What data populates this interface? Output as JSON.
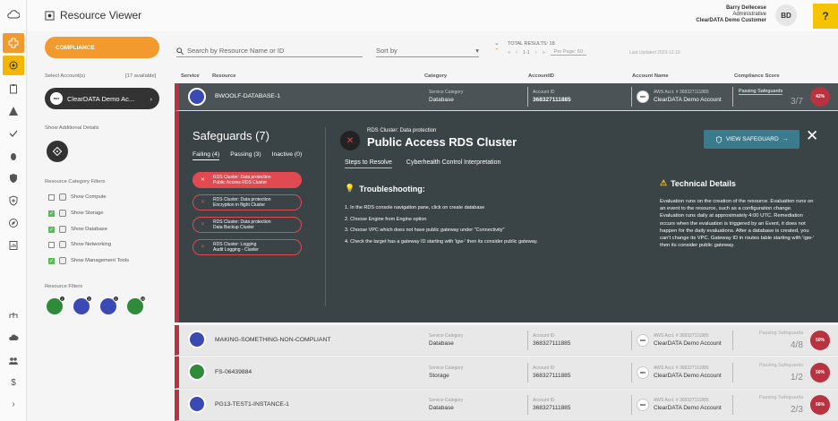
{
  "app": {
    "title": "Resource Viewer"
  },
  "user": {
    "name": "Barry Dellecese",
    "role": "Administrative",
    "org": "ClearDATA Demo Customer",
    "initials": "BD"
  },
  "help_label": "?",
  "rail_icons": [
    "cloud-gear-icon",
    "plus-network-icon",
    "target-icon",
    "clipboard-icon",
    "warning-icon",
    "check-icon",
    "bug-icon",
    "shield-icon",
    "shield-plus-icon",
    "compass-icon",
    "report-icon",
    "users-tree-icon",
    "cloud-upload-icon",
    "team-icon",
    "dollar-icon",
    "chevron-right-icon"
  ],
  "left": {
    "compliance_label": "COMPLIANCE",
    "select_accounts_label": "Select Account(s)",
    "available_label": "[17 available]",
    "account_badge": "aws",
    "account_name": "ClearDATA Demo Ac...",
    "show_details_label": "Show Additional Details",
    "category_filters_label": "Resource Category Filters",
    "categories": [
      {
        "label": "Show Compute",
        "checked": false
      },
      {
        "label": "Show Storage",
        "checked": true
      },
      {
        "label": "Show Database",
        "checked": true
      },
      {
        "label": "Show Networking",
        "checked": false
      },
      {
        "label": "Show Management Tools",
        "checked": true
      }
    ],
    "resource_filters_label": "Resource Filters",
    "resource_filters": [
      {
        "color": "green",
        "count": "1"
      },
      {
        "color": "blue",
        "count": "2"
      },
      {
        "color": "blue",
        "count": "2"
      },
      {
        "color": "green",
        "count": "13"
      }
    ]
  },
  "toolbar": {
    "search_placeholder": "Search by Resource Name or ID",
    "sort_label": "Sort by",
    "total_results": "TOTAL RESULTS: 18",
    "page_range": "1-1",
    "per_page": "Per Page: 50",
    "last_updated": "Last Updated 2023-12-19"
  },
  "columns": [
    "Service",
    "Resource",
    "Category",
    "AccountID",
    "Account Name",
    "Compliance Score"
  ],
  "rows": [
    {
      "name": "BWOOLF-DATABASE-1",
      "cat_label": "Service Category",
      "category": "Database",
      "acct_label": "Account ID",
      "account_id": "368327111885",
      "aws_acct": "AWS Acct. # 368327111885",
      "account_name": "ClearDATA Demo Account",
      "score_label": "Passing Safeguards",
      "score": "3/7",
      "pct": "42%"
    },
    {
      "name": "MAKING-SOMETHING-NON-COMPLIANT",
      "cat_label": "Service Category",
      "category": "Database",
      "acct_label": "Account ID",
      "account_id": "368327111885",
      "aws_acct": "AWS Acct. # 368327111885",
      "account_name": "ClearDATA Demo Account",
      "score_label": "Passing Safeguards",
      "score": "4/8",
      "pct": "50%"
    },
    {
      "name": "FS-06439884",
      "cat_label": "Service Category",
      "category": "Storage",
      "acct_label": "Account ID",
      "account_id": "368327111885",
      "aws_acct": "AWS Acct. # 368327111885",
      "account_name": "ClearDATA Demo Account",
      "score_label": "Passing Safeguards",
      "score": "1/2",
      "pct": "50%"
    },
    {
      "name": "PG13-TEST1-INSTANCE-1",
      "cat_label": "Service Category",
      "category": "Database",
      "acct_label": "Account ID",
      "account_id": "368327111885",
      "aws_acct": "AWS Acct. # 368327111885",
      "account_name": "ClearDATA Demo Account",
      "score_label": "Passing Safeguards",
      "score": "2/3",
      "pct": "66%"
    }
  ],
  "detail": {
    "safeguards_title": "Safeguards (7)",
    "tabs": [
      "Failing (4)",
      "Passing (3)",
      "Inactive (0)"
    ],
    "items": [
      {
        "l1": "RDS Cluster: Data protection",
        "l2": "Public Access RDS Cluster"
      },
      {
        "l1": "RDS Cluster: Data protection",
        "l2": "Encryption in flight Cluster"
      },
      {
        "l1": "RDS Cluster: Data protection",
        "l2": "Data Backup Cluster"
      },
      {
        "l1": "RDS Cluster: Logging",
        "l2": "Audit Logging - Cluster"
      }
    ],
    "subtitle": "RDS Cluster: Data protection",
    "title": "Public Access RDS Cluster",
    "detail_tabs": [
      "Steps to Resolve",
      "Cyberhealth Control Interpretation"
    ],
    "view_button": "VIEW SAFEGUARD",
    "troubleshooting_title": "Troubleshooting:",
    "steps": [
      "1. In the RDS console navigation pane, click on create database",
      "2. Choose Engine from Engine option",
      "3. Choose VPC which does not have public gateway under \"Connectivity\"",
      "4. Check the target has a gateway ID starting with 'igw-' then its consider public gateway."
    ],
    "technical_title": "Technical Details",
    "technical_body": "Evaluation runs on the creation of the resource. Evaluation runs on an event to the resource, such as a configuration change. Evaluation runs daily at approximately 4:00 UTC. Remediation occurs when the evaluation is triggered by an Event, it does not happen for the daily evaluations. After a database is created, you can't change its VPC. Gateway ID in routes table starting with 'igw-' then its consider public gateway."
  }
}
